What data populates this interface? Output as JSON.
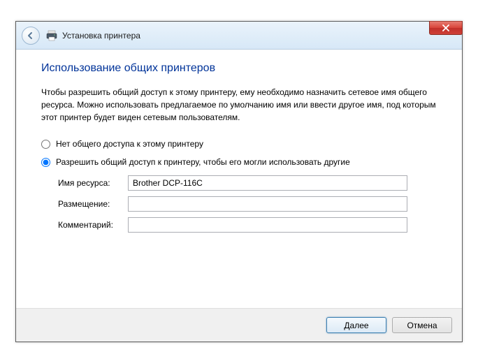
{
  "titlebar": {
    "title": "Установка принтера"
  },
  "content": {
    "heading": "Использование общих принтеров",
    "description": "Чтобы разрешить общий доступ к этому принтеру, ему необходимо назначить сетевое имя общего ресурса. Можно использовать предлагаемое по умолчанию имя или ввести другое имя, под которым этот принтер будет виден сетевым пользователям.",
    "radio_no_share": "Нет общего доступа к этому принтеру",
    "radio_share": "Разрешить общий доступ к принтеру, чтобы его могли использовать другие",
    "share_name_label": "Имя ресурса:",
    "share_name_value": "Brother DCP-116C",
    "location_label": "Размещение:",
    "location_value": "",
    "comment_label": "Комментарий:",
    "comment_value": ""
  },
  "footer": {
    "next": "Далее",
    "cancel": "Отмена"
  }
}
